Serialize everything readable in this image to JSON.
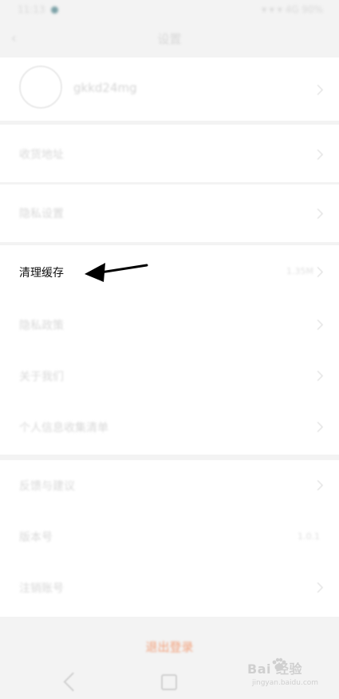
{
  "status_bar": {
    "time": "11:13",
    "right_info": "▾ ▾ ▾ 4G 90%"
  },
  "header": {
    "title": "设置"
  },
  "profile": {
    "username": "gkkd24mg"
  },
  "sections": {
    "account": "收货地址",
    "privacy": "隐私设置",
    "cache": {
      "label": "清理缓存",
      "value": "1.35M"
    },
    "notifications": "隐私政策",
    "about": "关于我们",
    "personal_info": "个人信息收集清单",
    "help": "反馈与建议",
    "version": {
      "label": "版本号",
      "value": "1.0.1"
    },
    "logoff": "注销账号"
  },
  "logout": {
    "label": "退出登录"
  },
  "watermark": {
    "brand": "Bai 经验",
    "url": "jingyan.baidu.com"
  },
  "colors": {
    "background": "#f3f3f3",
    "accent_logout": "#f2a07b"
  }
}
